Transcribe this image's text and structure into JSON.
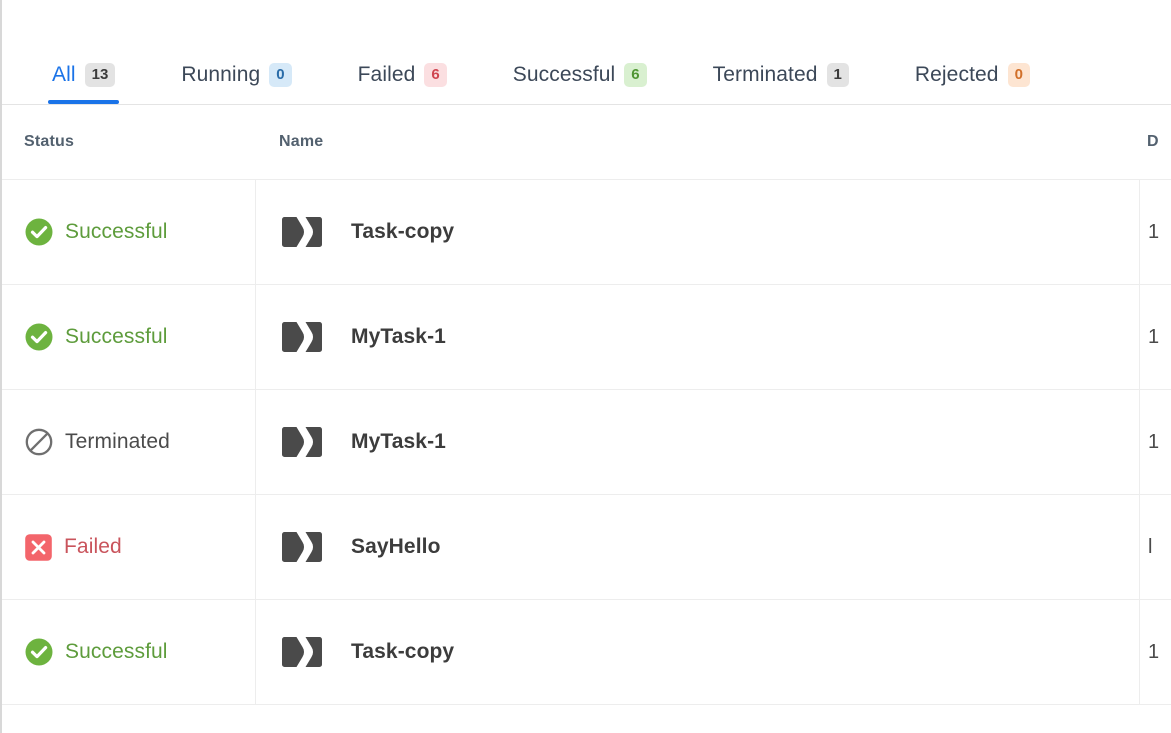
{
  "tabs": [
    {
      "label": "All",
      "count": "13",
      "active": true,
      "badge_class": "cnt-all",
      "name": "tab-all"
    },
    {
      "label": "Running",
      "count": "0",
      "active": false,
      "badge_class": "cnt-run",
      "name": "tab-running"
    },
    {
      "label": "Failed",
      "count": "6",
      "active": false,
      "badge_class": "cnt-fail",
      "name": "tab-failed"
    },
    {
      "label": "Successful",
      "count": "6",
      "active": false,
      "badge_class": "cnt-succ",
      "name": "tab-successful"
    },
    {
      "label": "Terminated",
      "count": "1",
      "active": false,
      "badge_class": "cnt-term",
      "name": "tab-terminated"
    },
    {
      "label": "Rejected",
      "count": "0",
      "active": false,
      "badge_class": "cnt-rej",
      "name": "tab-rejected"
    }
  ],
  "table": {
    "headers": {
      "status": "Status",
      "name": "Name",
      "date": "D"
    },
    "rows": [
      {
        "status": "Successful",
        "status_icon": "check-circle-icon",
        "status_class": "st-successful",
        "name": "Task-copy",
        "task_icon": "workflow-task-icon",
        "date": "1"
      },
      {
        "status": "Successful",
        "status_icon": "check-circle-icon",
        "status_class": "st-successful",
        "name": "MyTask-1",
        "task_icon": "workflow-task-icon",
        "date": "1"
      },
      {
        "status": "Terminated",
        "status_icon": "prohibited-circle-icon",
        "status_class": "st-terminated",
        "name": "MyTask-1",
        "task_icon": "workflow-task-icon",
        "date": "1"
      },
      {
        "status": "Failed",
        "status_icon": "x-square-icon",
        "status_class": "st-failed",
        "name": "SayHello",
        "task_icon": "workflow-task-icon",
        "date": "l"
      },
      {
        "status": "Successful",
        "status_icon": "check-circle-icon",
        "status_class": "st-successful",
        "name": "Task-copy",
        "task_icon": "workflow-task-icon",
        "date": "1"
      }
    ]
  },
  "colors": {
    "accent_blue": "#1a73e8",
    "success_green": "#6db33f",
    "failed_red": "#f3656b",
    "terminated_gray": "#6f6f6f",
    "rejected_orange": "#d1702a"
  }
}
